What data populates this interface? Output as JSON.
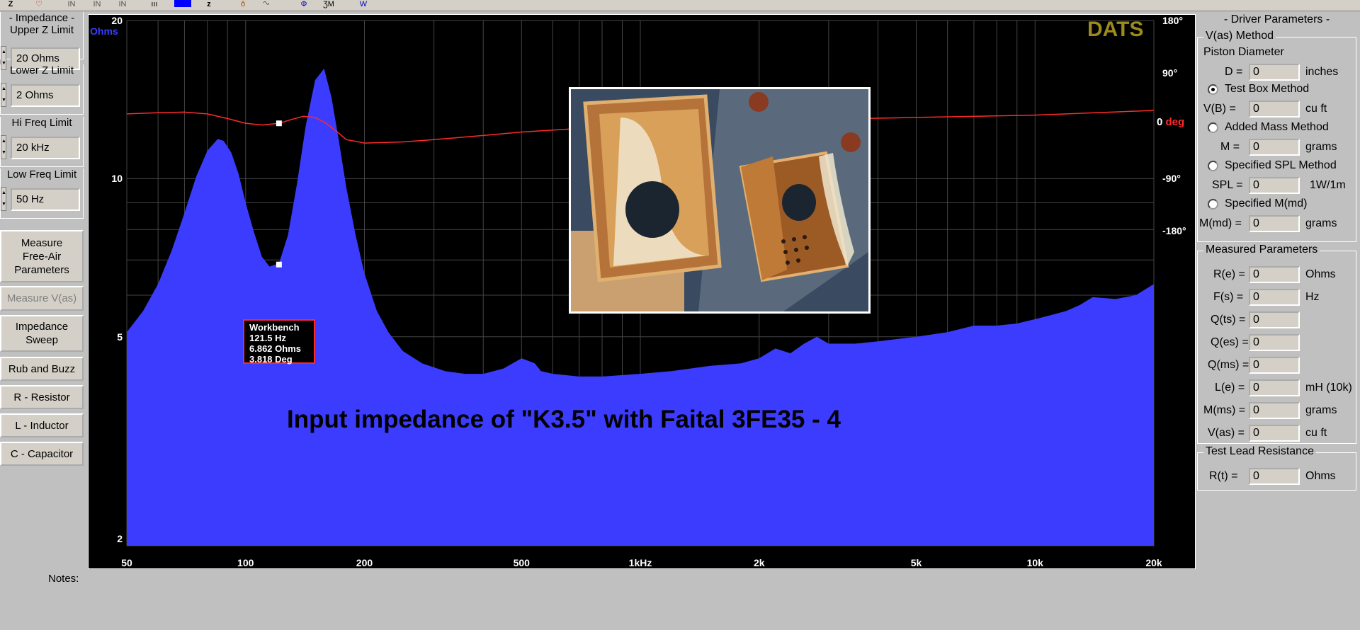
{
  "toolbar": {
    "icons": [
      "z-icon",
      "v-icon",
      "n-icon",
      "n-icon",
      "n-icon",
      "bars-icon",
      "blue-rect-icon",
      "z-icon",
      "knob-icon",
      "wave-icon",
      "phi-icon",
      "zm-icon",
      "w-icon"
    ]
  },
  "left": {
    "impedance_label": "- Impedance -",
    "upper_z_label": "Upper Z Limit",
    "upper_z_value": "20 Ohms",
    "lower_z_label": "Lower Z Limit",
    "lower_z_value": "2 Ohms",
    "hi_freq_label": "Hi Freq Limit",
    "hi_freq_value": "20 kHz",
    "low_freq_label": "Low Freq Limit",
    "low_freq_value": "50 Hz",
    "buttons": [
      "Measure\nFree-Air\nParameters",
      "Measure V(as)",
      "Impedance\nSweep",
      "Rub and Buzz",
      "R - Resistor",
      "L - Inductor",
      "C - Capacitor"
    ]
  },
  "plot": {
    "units": "Ohms",
    "brand": "DATS",
    "deg_prefix": "0",
    "deg_unit": "deg",
    "title": "Input impedance of \"K3.5\" with Faital 3FE35 - 4",
    "cursor": {
      "name": "Workbench",
      "freq": "121.5 Hz",
      "ohms": "6.862 Ohms",
      "deg": "3.818 Deg"
    }
  },
  "chart_data": {
    "type": "area",
    "title": "Input impedance of \"K3.5\" with Faital 3FE35 - 4",
    "xlabel": "",
    "ylabel": "Ohms",
    "x_scale": "log",
    "y_scale": "log",
    "xlim": [
      50,
      20000
    ],
    "ylim": [
      2,
      20
    ],
    "x_tick_labels": [
      "50",
      "100",
      "200",
      "500",
      "1kHz",
      "2k",
      "5k",
      "10k",
      "20k"
    ],
    "y_tick_labels": [
      "20",
      "10",
      "5",
      "2"
    ],
    "y2_tick_labels": [
      "180°",
      "90°",
      "0 deg",
      "-90°",
      "-180°"
    ],
    "y2lim": [
      -180,
      180
    ],
    "grid": true,
    "series": [
      {
        "name": "",
        "axis": "left",
        "color": "#3c3cff",
        "x": [
          50,
          55,
          60,
          65,
          70,
          75,
          80,
          85,
          88,
          92,
          96,
          100,
          105,
          110,
          115,
          121.5,
          128,
          135,
          142,
          150,
          158,
          165,
          172,
          180,
          190,
          200,
          215,
          230,
          250,
          280,
          320,
          360,
          400,
          450,
          500,
          540,
          560,
          600,
          700,
          800,
          1000,
          1200,
          1500,
          1800,
          2000,
          2200,
          2400,
          2600,
          2800,
          3000,
          3500,
          4000,
          5000,
          6000,
          7000,
          8000,
          9000,
          10000,
          11000,
          12000,
          13000,
          14000,
          16000,
          18000,
          20000
        ],
        "y": [
          5.1,
          5.6,
          6.3,
          7.3,
          8.6,
          10.1,
          11.3,
          11.9,
          11.8,
          11.2,
          10.2,
          9.0,
          7.9,
          7.1,
          6.8,
          6.9,
          7.8,
          9.8,
          12.6,
          15.4,
          16.2,
          14.3,
          11.9,
          9.6,
          7.8,
          6.6,
          5.6,
          5.1,
          4.7,
          4.45,
          4.3,
          4.25,
          4.25,
          4.35,
          4.55,
          4.45,
          4.3,
          4.25,
          4.2,
          4.2,
          4.25,
          4.3,
          4.4,
          4.45,
          4.55,
          4.75,
          4.65,
          4.85,
          5.0,
          4.85,
          4.85,
          4.9,
          5.0,
          5.1,
          5.25,
          5.25,
          5.3,
          5.4,
          5.5,
          5.6,
          5.75,
          5.95,
          5.9,
          6.0,
          6.3
        ]
      },
      {
        "name": "",
        "axis": "right",
        "color": "#ff2a2a",
        "x": [
          50,
          60,
          70,
          80,
          90,
          100,
          110,
          121.5,
          130,
          140,
          150,
          160,
          170,
          180,
          200,
          250,
          300,
          400,
          500,
          700,
          1000,
          1500,
          2000,
          3000,
          5000,
          10000,
          20000
        ],
        "y": [
          20,
          22,
          23,
          20,
          12,
          4,
          1,
          3.8,
          10,
          16,
          14,
          4,
          -10,
          -24,
          -30,
          -28,
          -24,
          -17,
          -11,
          -5,
          0,
          4,
          7,
          11,
          14,
          18,
          26
        ]
      }
    ]
  }
}
